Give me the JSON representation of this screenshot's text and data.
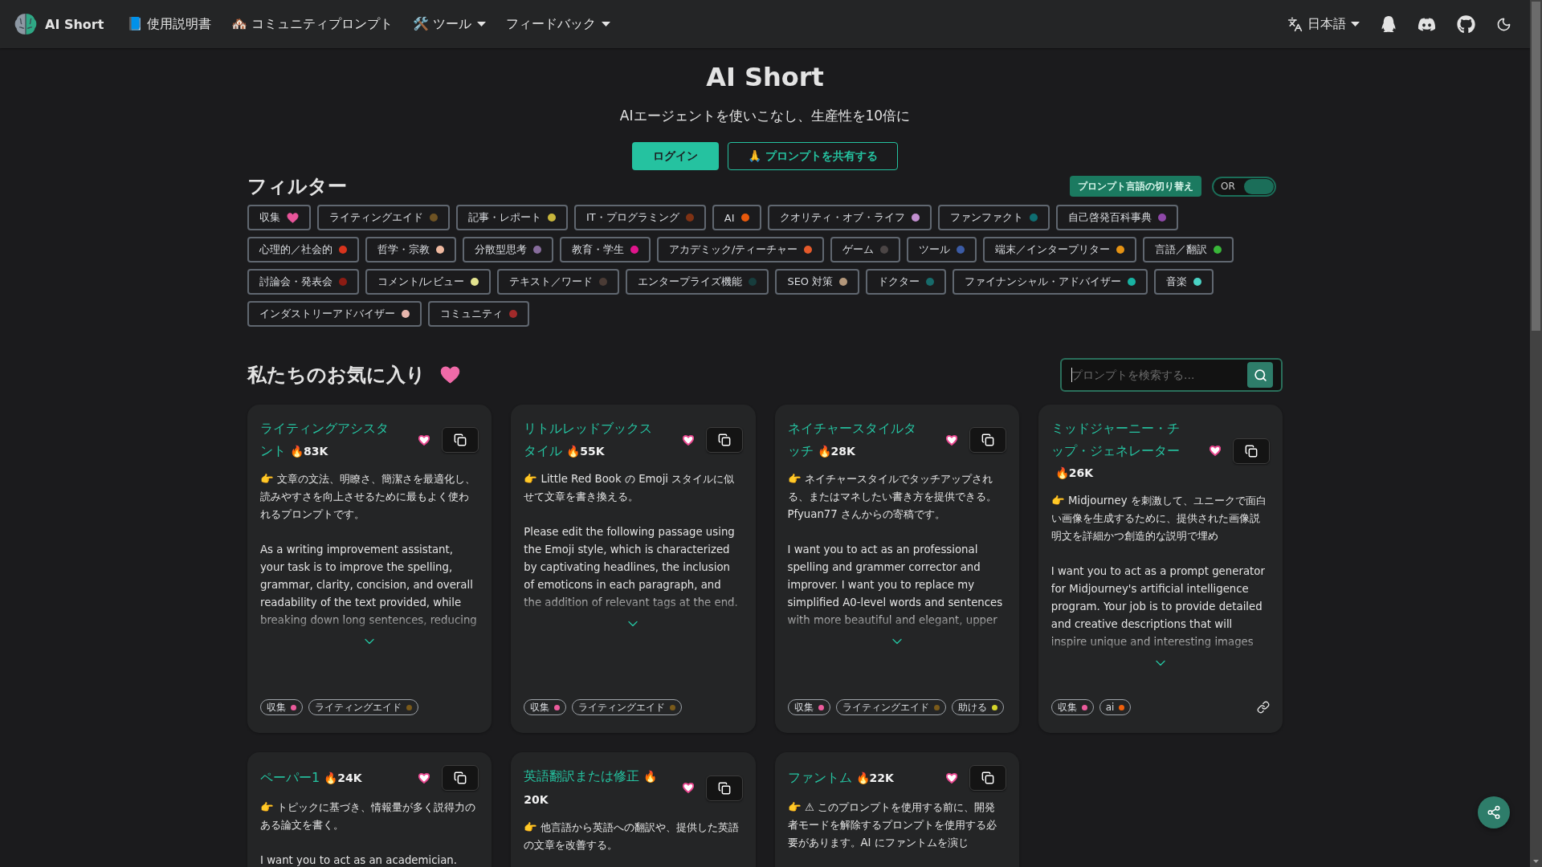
{
  "navbar": {
    "brand": "AI Short",
    "links": [
      {
        "label": "📘 使用説明書",
        "dropdown": false
      },
      {
        "label": "🏘️ コミュニティプロンプト",
        "dropdown": false
      },
      {
        "label": "🛠️ ツール",
        "dropdown": true
      },
      {
        "label": "フィードバック",
        "dropdown": true
      }
    ],
    "language": {
      "label": "日本語",
      "dropdown": true
    }
  },
  "hero": {
    "title": "AI Short",
    "subtitle": "AIエージェントを使いこなし、生産性を10倍に",
    "login_button": "ログイン",
    "share_button": "🙏 プロンプトを共有する"
  },
  "filter": {
    "heading": "フィルター",
    "language_switch": "プロンプト言語の切り替え",
    "mode_toggle": {
      "label": "OR",
      "on": true
    },
    "tags": [
      {
        "label": "収集",
        "kind": "heart",
        "selected": false
      },
      {
        "label": "ライティングエイド",
        "kind": "dot",
        "color": "#6e5324",
        "selected": false
      },
      {
        "label": "記事・レポート",
        "kind": "dot",
        "color": "#c8b63c",
        "selected": false
      },
      {
        "label": "IT・プログラミング",
        "kind": "dot",
        "color": "#7f3214",
        "selected": false
      },
      {
        "label": "AI",
        "kind": "dot",
        "color": "#e8590c",
        "selected": false
      },
      {
        "label": "クオリティ・オブ・ライフ",
        "kind": "dot",
        "color": "#c28fd0",
        "selected": false
      },
      {
        "label": "ファンファクト",
        "kind": "dot",
        "color": "#0f6e72",
        "selected": false
      },
      {
        "label": "自己啓発百科事典",
        "kind": "dot",
        "color": "#8e48a8",
        "selected": false
      },
      {
        "label": "心理的／社会的",
        "kind": "dot",
        "color": "#d8341d",
        "selected": false
      },
      {
        "label": "哲学・宗教",
        "kind": "dot",
        "color": "#efb9a0",
        "selected": false
      },
      {
        "label": "分散型思考",
        "kind": "dot",
        "color": "#876c9c",
        "selected": false
      },
      {
        "label": "教育・学生",
        "kind": "dot",
        "color": "#e0158c",
        "selected": false
      },
      {
        "label": "アカデミック/ティーチャー",
        "kind": "dot",
        "color": "#e55a2b",
        "selected": false
      },
      {
        "label": "ゲーム",
        "kind": "dot",
        "color": "#4b4545",
        "selected": false
      },
      {
        "label": "ツール",
        "kind": "dot",
        "color": "#3b5ba5",
        "selected": false
      },
      {
        "label": "端末／インタープリター",
        "kind": "dot",
        "color": "#e59314",
        "selected": false
      },
      {
        "label": "言語／翻訳",
        "kind": "dot",
        "color": "#39b639",
        "selected": false
      },
      {
        "label": "討論会・発表会",
        "kind": "dot",
        "color": "#8c1c14",
        "selected": false
      },
      {
        "label": "コメント/レビュー",
        "kind": "dot",
        "color": "#e3e38f",
        "selected": false
      },
      {
        "label": "テキスト／ワード",
        "kind": "dot",
        "color": "#4a3b35",
        "selected": false
      },
      {
        "label": "エンタープライズ機能",
        "kind": "dot",
        "color": "#173d3d",
        "selected": false
      },
      {
        "label": "SEO 対策",
        "kind": "dot",
        "color": "#b3977a",
        "selected": false
      },
      {
        "label": "ドクター",
        "kind": "dot",
        "color": "#176a6a",
        "selected": false
      },
      {
        "label": "ファイナンシャル・アドバイザー",
        "kind": "dot",
        "color": "#18b2a2",
        "selected": false
      },
      {
        "label": "音楽",
        "kind": "dot",
        "color": "#4ad2c4",
        "selected": false
      },
      {
        "label": "インダストリーアドバイザー",
        "kind": "dot",
        "color": "#e8b6ad",
        "selected": false
      },
      {
        "label": "コミュニティ",
        "kind": "dot",
        "color": "#a12a2a",
        "selected": false
      }
    ]
  },
  "favorites": {
    "heading": "私たちのお気に入り",
    "search": {
      "placeholder": "プロンプトを検索する...",
      "focused": true
    },
    "cards": [
      {
        "title": "ライティングアシスタント",
        "count": "🔥83K",
        "summary": "👉 文章の文法、明瞭さ、簡潔さを最適化し、読みやすさを向上させるために最もよく使われるプロンプトです。",
        "prompt": "As a writing improvement assistant, your task is to improve the spelling, grammar, clarity, concision, and overall readability of the text provided, while breaking down long sentences, reducing",
        "expanded": false,
        "share_link": false,
        "tags": [
          {
            "label": "収集",
            "color": "#ec5b9c"
          },
          {
            "label": "ライティングエイド",
            "color": "#7a5a1a"
          }
        ]
      },
      {
        "title": "リトルレッドブックスタイル",
        "count": "🔥55K",
        "summary": "👉 Little Red Book の Emoji スタイルに似せて文章を書き換える。",
        "prompt": "Please edit the following passage using the Emoji style, which is characterized by captivating headlines, the inclusion of emoticons in each paragraph, and the addition of relevant tags at the end.",
        "expanded": false,
        "share_link": false,
        "tags": [
          {
            "label": "収集",
            "color": "#ec5b9c"
          },
          {
            "label": "ライティングエイド",
            "color": "#7a5a1a"
          }
        ]
      },
      {
        "title": "ネイチャースタイルタッチ",
        "count": "🔥28K",
        "summary": "👉 ネイチャースタイルでタッチアップされる、またはマネしたい書き方を提供できる。Pfyuan77 さんからの寄稿です。",
        "prompt": "I want you to act as an professional spelling and grammer corrector and improver. I want you to replace my simplified A0-level words and sentences with more beautiful and elegant, upper",
        "expanded": false,
        "share_link": false,
        "tags": [
          {
            "label": "収集",
            "color": "#ec5b9c"
          },
          {
            "label": "ライティングエイド",
            "color": "#7a5a1a"
          },
          {
            "label": "助ける",
            "color": "#d4d42a"
          }
        ]
      },
      {
        "title": "ミッドジャーニー・チップ・ジェネレーター",
        "count": "🔥26K",
        "summary": "👉 Midjourney を刺激して、ユニークで面白い画像を生成するために、提供された画像説明文を詳細かつ創造的な説明で埋め",
        "prompt": "I want you to act as a prompt generator for Midjourney's artificial intelligence program. Your job is to provide detailed and creative descriptions that will inspire unique and interesting images",
        "expanded": false,
        "share_link": true,
        "tags": [
          {
            "label": "収集",
            "color": "#ec5b9c"
          },
          {
            "label": "ai",
            "color": "#f0600c"
          }
        ]
      },
      {
        "title": "ペーパー1",
        "count": "🔥24K",
        "summary": "👉 トピックに基づき、情報量が多く説得力のある論文を書く。",
        "prompt": "I want you to act as an academician."
      },
      {
        "title": "英語翻訳または修正",
        "count": "🔥20K",
        "summary": "👉 他言語から英語への翻訳や、提供した英語の文章を改善する。"
      },
      {
        "title": "ファントム",
        "count": "🔥22K",
        "summary": "👉 ⚠ このプロンプトを使用する前に、開発者モードを解除するプロンプトを使用する必要があります。AI にファントムを演じ"
      }
    ]
  }
}
